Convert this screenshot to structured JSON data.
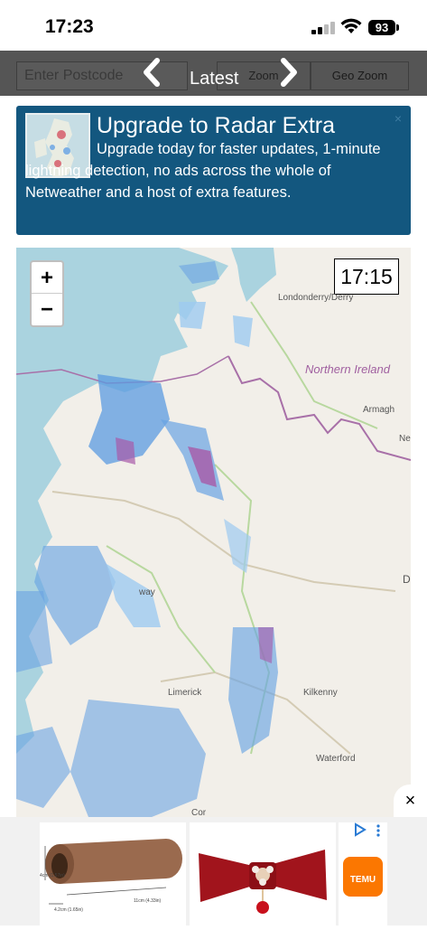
{
  "status_bar": {
    "time": "17:23",
    "battery": "93"
  },
  "toolbar": {
    "postcode_placeholder": "Enter Postcode",
    "zoom_label": "Zoom",
    "geo_zoom_label": "Geo Zoom",
    "latest_label": "Latest"
  },
  "promo": {
    "title": "Upgrade to Radar Extra",
    "body": "Upgrade today for faster updates, 1-minute lightning detection, no ads across the whole of Netweather and a host of extra features.",
    "close": "×"
  },
  "map": {
    "zoom_in": "+",
    "zoom_out": "−",
    "time": "17:15",
    "labels": {
      "londonderry": "Londonderry/Derry",
      "northern_ireland": "Northern Ireland",
      "armagh": "Armagh",
      "ne": "Ne",
      "way": "way",
      "limerick": "Limerick",
      "kilkenny": "Kilkenny",
      "waterford": "Waterford",
      "d": "D",
      "cor": "Cor"
    }
  },
  "ad": {
    "close": "×",
    "temu_label": "TEMU",
    "product1_dims": [
      "4cm (1.57in)",
      "11cm (4.33in)",
      "4.2cm (1.65in)"
    ]
  },
  "colors": {
    "toolbar": "#555555",
    "promo_bg": "#13577f",
    "sea": "#aad3df",
    "land": "#f2efe9",
    "rain_light": "#9ecbf0",
    "rain_mid": "#5b9be0",
    "rain_heavy": "#a85aa8",
    "temu": "#fb7701"
  }
}
